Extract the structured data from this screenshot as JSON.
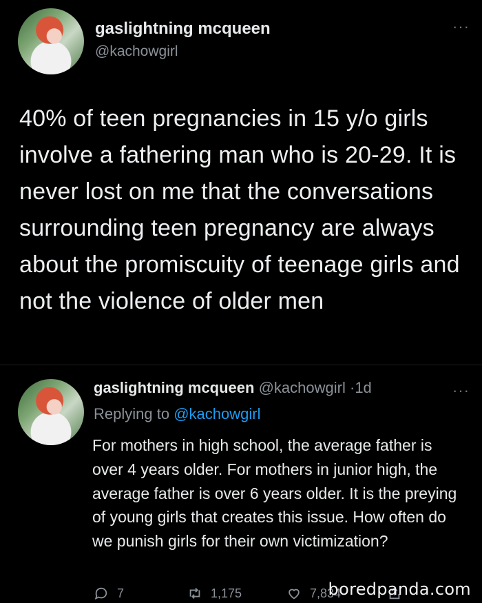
{
  "main_tweet": {
    "display_name": "gaslightning mcqueen",
    "handle": "@kachowgirl",
    "text": "40% of teen pregnancies in 15 y/o girls involve a fathering man who is 20-29. It is never lost on me that the conversations surrounding teen pregnancy are always about the promiscuity of teenage girls and not the violence of older men",
    "more_icon": "···"
  },
  "reply_tweet": {
    "display_name": "gaslightning mcqueen",
    "handle": "@kachowgirl",
    "separator": "·",
    "time": "1d",
    "replying_prefix": "Replying to ",
    "replying_handle": "@kachowgirl",
    "text": "For mothers in high school, the average father is over 4 years older. For mothers in junior high, the average father is over 6 years older. It is the preying of young girls that creates this issue. How often do we punish girls for their own victimization?",
    "more_icon": "···",
    "reply_count": "7",
    "retweet_count": "1,175",
    "like_count": "7,834"
  },
  "watermark": "boredpanda.com",
  "icons": {
    "reply": "comment-bubble-icon",
    "retweet": "retweet-icon",
    "like": "heart-icon",
    "share": "share-icon",
    "more": "more-dots-icon"
  },
  "colors": {
    "background": "#000000",
    "text": "#e7e9ea",
    "secondary": "#8b9198",
    "link": "#1d9bf0"
  }
}
